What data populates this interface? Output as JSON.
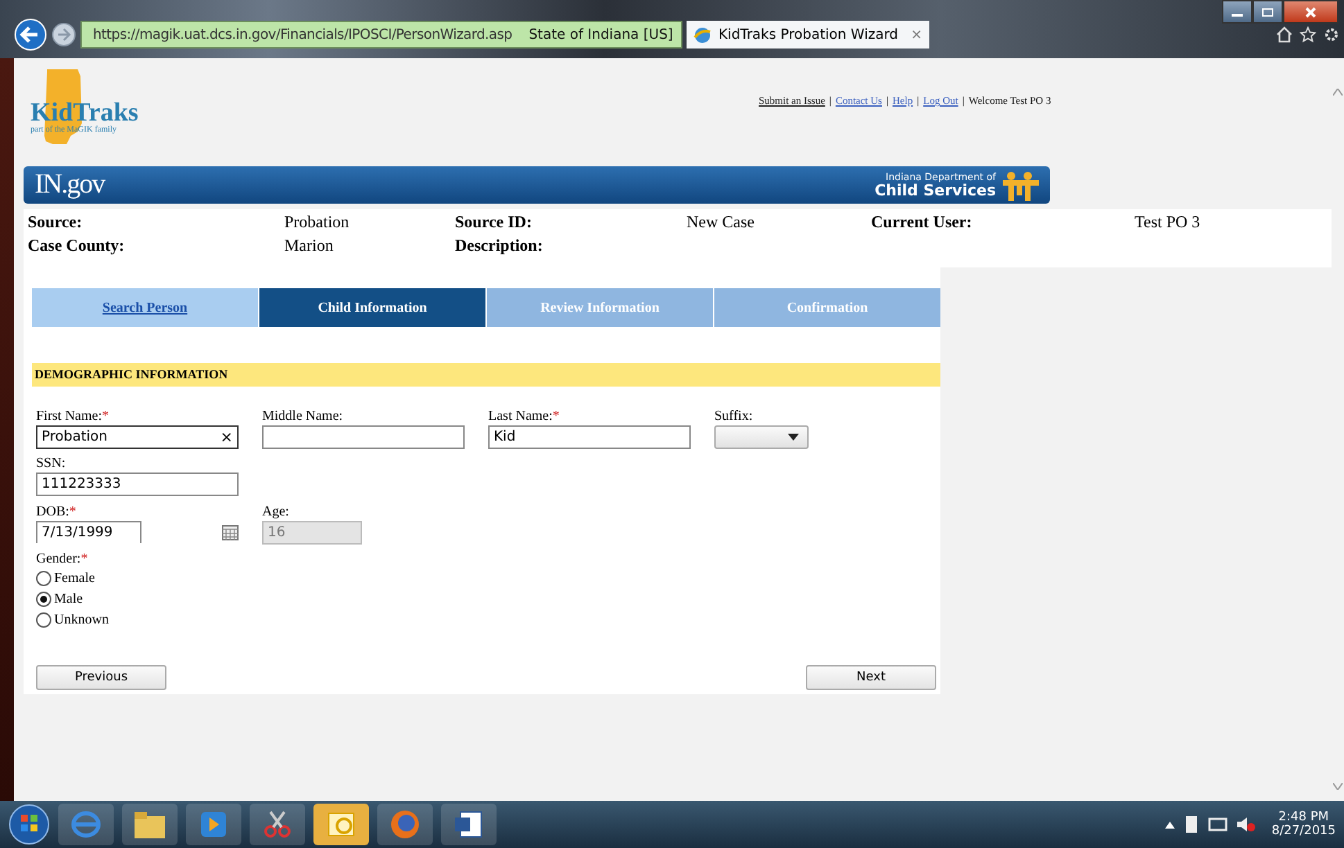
{
  "browser": {
    "address": "https://magik.uat.dcs.in.gov/Financials/IPOSCI/PersonWizard.asp",
    "security": "State of Indiana [US]",
    "tab": "KidTraks Probation Wizard",
    "tab_close": "×"
  },
  "header": {
    "logo": "KidTraks",
    "tagline": "part of the MaGIK family",
    "links": [
      {
        "label": "Submit an Issue",
        "separator": "|"
      },
      {
        "label": "Contact Us",
        "separator": "|"
      },
      {
        "label": "Help",
        "separator": "|"
      },
      {
        "label": "Log Out",
        "separator": "|"
      }
    ],
    "welcome": "Welcome Test PO 3",
    "banner_left": "IN.gov",
    "banner_right_top": "Indiana Department of",
    "banner_right_bottom": "Child Services"
  },
  "case_info": [
    {
      "label": "Source:",
      "value": "Probation"
    },
    {
      "label": "Source ID:",
      "value": "New Case"
    },
    {
      "label": "Current User:",
      "value": "Test PO 3"
    },
    {
      "label": "Case County:",
      "value": "Marion"
    },
    {
      "label": "Description:"
    }
  ],
  "steps": [
    {
      "label": "Search Person",
      "selected": false,
      "disabled": false
    },
    {
      "label": "Child Information",
      "selected": true,
      "disabled": false
    },
    {
      "label": "Review Information",
      "selected": false,
      "disabled": true
    },
    {
      "label": "Confirmation",
      "selected": false,
      "disabled": true
    }
  ],
  "section_title": "DEMOGRAPHIC INFORMATION",
  "name_fields": [
    {
      "label": "First Name:",
      "required_mark": "*",
      "value": "Probation",
      "clear": "×"
    },
    {
      "label": "Middle Name:"
    },
    {
      "label": "Last Name:",
      "required_mark": "*",
      "value": "Kid"
    }
  ],
  "suffix": {
    "label": "Suffix:"
  },
  "ssn": {
    "label": "SSN:",
    "value": "111223333"
  },
  "dob": {
    "label": "DOB:",
    "required_mark": "*",
    "value": "7/13/1999"
  },
  "age": {
    "label": "Age:",
    "value": "16",
    "disabled": true
  },
  "gender": {
    "label": "Gender:",
    "required_mark": "*",
    "options": [
      {
        "label": "Female",
        "selected": false
      },
      {
        "label": "Male",
        "selected": true
      },
      {
        "label": "Unknown",
        "selected": false
      }
    ]
  },
  "buttons": [
    {
      "label": "Previous"
    },
    {
      "label": "Next"
    }
  ],
  "taskbar": {
    "time": "2:48 PM",
    "date": "8/27/2015"
  }
}
